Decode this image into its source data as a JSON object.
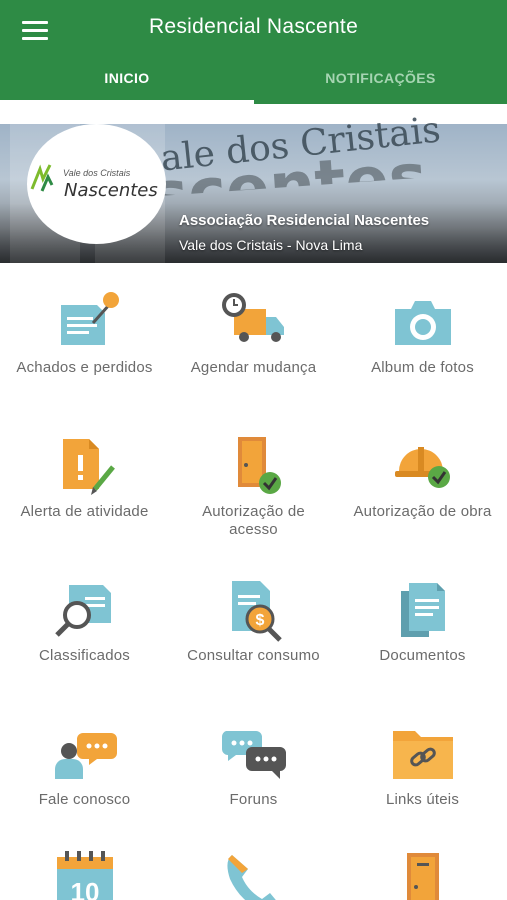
{
  "app": {
    "title": "Residencial Nascente",
    "menu_icon": "hamburger-menu-icon"
  },
  "tabs": [
    {
      "label": "INICIO",
      "active": true
    },
    {
      "label": "NOTIFICAÇÕES",
      "active": false
    }
  ],
  "colors": {
    "primary": "#2e8b45",
    "tab_inactive": "#a6d5b2",
    "label": "#6b6b6b"
  },
  "banner": {
    "logo_small": "Vale dos Cristais",
    "logo_big": "Nascentes",
    "sign_text_1": "ale dos Cristais",
    "sign_text_2": "scentes",
    "title": "Associação Residencial Nascentes",
    "subtitle": "Vale dos Cristais - Nova Lima"
  },
  "tiles": [
    {
      "label": "Achados e perdidos",
      "icon": "lost-found-icon"
    },
    {
      "label": "Agendar mudança",
      "icon": "moving-truck-icon"
    },
    {
      "label": "Album de fotos",
      "icon": "camera-icon"
    },
    {
      "label": "Alerta de atividade",
      "icon": "alert-document-icon"
    },
    {
      "label": "Autorização de acesso",
      "icon": "door-check-icon"
    },
    {
      "label": "Autorização de obra",
      "icon": "hardhat-check-icon"
    },
    {
      "label": "Classificados",
      "icon": "classifieds-search-icon"
    },
    {
      "label": "Consultar consumo",
      "icon": "consumption-search-icon"
    },
    {
      "label": "Documentos",
      "icon": "documents-icon"
    },
    {
      "label": "Fale conosco",
      "icon": "chat-person-icon"
    },
    {
      "label": "Foruns",
      "icon": "forum-bubbles-icon"
    },
    {
      "label": "Links úteis",
      "icon": "folder-link-icon"
    },
    {
      "label": "",
      "icon": "calendar-icon",
      "day": "10"
    },
    {
      "label": "",
      "icon": "phone-icon"
    },
    {
      "label": "",
      "icon": "door-icon"
    }
  ]
}
